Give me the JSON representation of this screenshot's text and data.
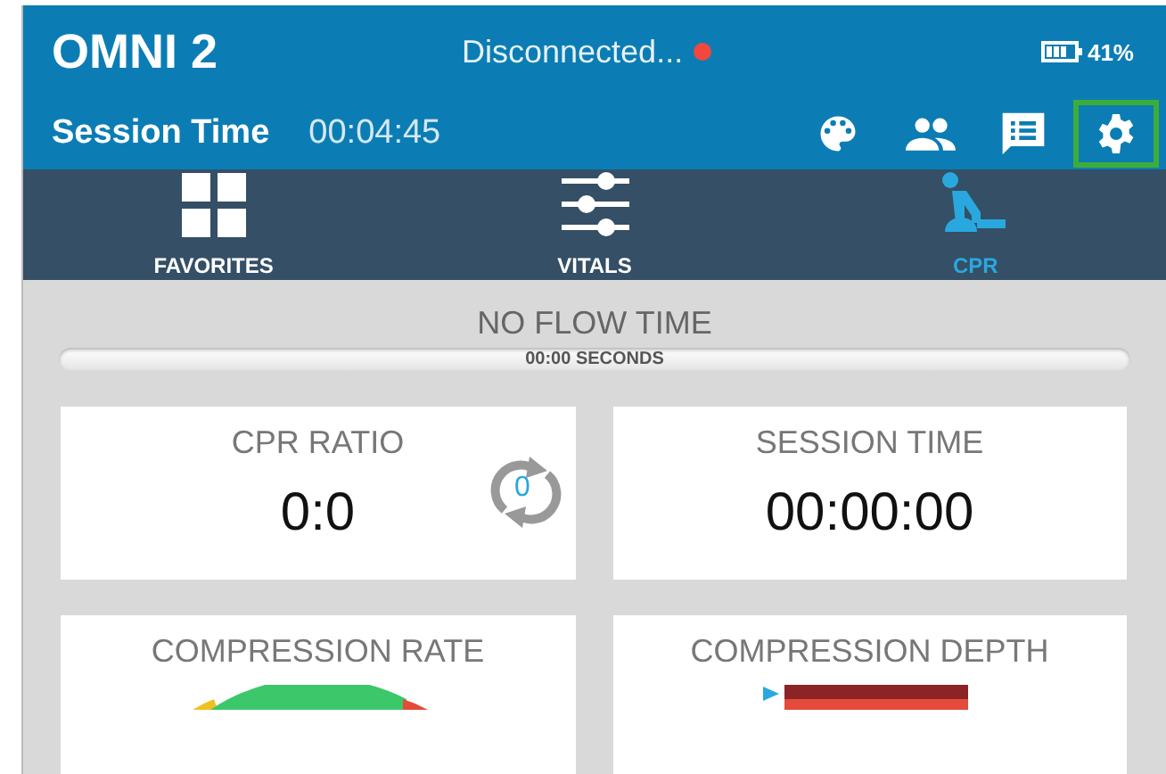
{
  "header": {
    "title": "OMNI 2",
    "connection": "Disconnected...",
    "connected": false,
    "battery": "41%",
    "session_label": "Session Time",
    "session_time": "00:04:45",
    "tools": [
      {
        "kind": "palette",
        "highlighted": false
      },
      {
        "kind": "people",
        "highlighted": false
      },
      {
        "kind": "notes",
        "highlighted": false
      },
      {
        "kind": "settings",
        "highlighted": true
      }
    ]
  },
  "tabs": [
    {
      "label": "FAVORITES",
      "kind": "grid",
      "selected": false
    },
    {
      "label": "VITALS",
      "kind": "sliders",
      "selected": false
    },
    {
      "label": "CPR",
      "kind": "cpr",
      "selected": true
    }
  ],
  "no_flow": {
    "title": "NO FLOW TIME",
    "reading": "00:00 SECONDS",
    "level": 0
  },
  "cards": [
    {
      "title": "CPR RATIO",
      "value": "0:0",
      "kind": "ratio",
      "cycle_count": "0"
    },
    {
      "title": "SESSION TIME",
      "value": "00:00:00",
      "kind": "plain"
    },
    {
      "title": "COMPRESSION RATE",
      "kind": "gauge"
    },
    {
      "title": "COMPRESSION DEPTH",
      "kind": "depth"
    }
  ]
}
